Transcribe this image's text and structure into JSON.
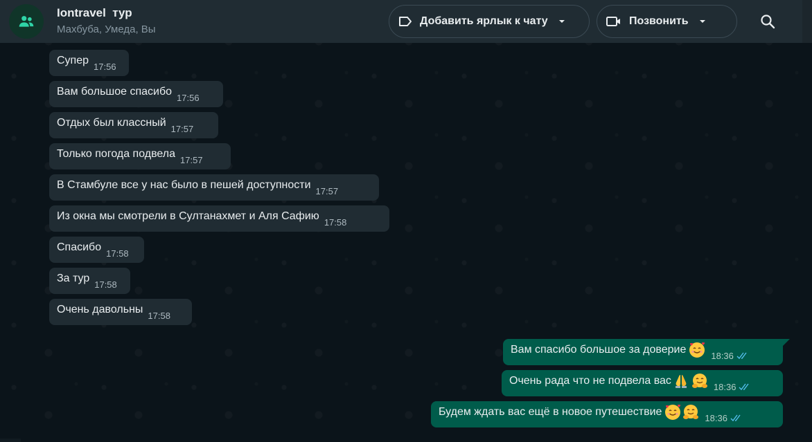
{
  "header": {
    "title": "Iontravel  тур",
    "members": "Махбуба, Умеда, Вы",
    "label_button": "Добавить ярлык к чату",
    "call_button": "Позвонить",
    "icons": {
      "avatar": "group-icon",
      "label": "label-tag-icon",
      "call": "video-camera-icon",
      "search": "search-icon"
    }
  },
  "colors": {
    "background": "#0b141a",
    "incoming_bubble": "#202c33",
    "outgoing_bubble": "#005c4b",
    "read_ticks": "#53bdeb"
  },
  "messages": [
    {
      "text": "Супер",
      "time": "17:56"
    },
    {
      "text": "Вам большое спасибо",
      "time": "17:56"
    },
    {
      "text": "Отдых был классный",
      "time": "17:57"
    },
    {
      "text": "Только погода подвела",
      "time": "17:57"
    },
    {
      "text": "В Стамбуле все у нас было в пешей доступности",
      "time": "17:57"
    },
    {
      "text": "Из окна мы смотрели в Султанахмет и Аля Сафию",
      "time": "17:58"
    },
    {
      "text": "Спасибо",
      "time": "17:58"
    },
    {
      "text": "За тур",
      "time": "17:58"
    },
    {
      "text": "Очень давольны",
      "time": "17:58"
    },
    {
      "text": "Вам спасибо большое за доверие",
      "time": "18:36",
      "emoji": [
        "smiling-face-with-hearts-emoji"
      ],
      "status": "read"
    },
    {
      "text": "Очень рада что не подвела вас",
      "time": "18:36",
      "emoji": [
        "folded-hands-emoji",
        "hugging-face-emoji"
      ],
      "status": "read"
    },
    {
      "text": "Будем ждать вас ещё в новое путешествие",
      "time": "18:36",
      "emoji": [
        "smiling-face-with-hearts-emoji",
        "hugging-face-emoji"
      ],
      "status": "read"
    }
  ]
}
